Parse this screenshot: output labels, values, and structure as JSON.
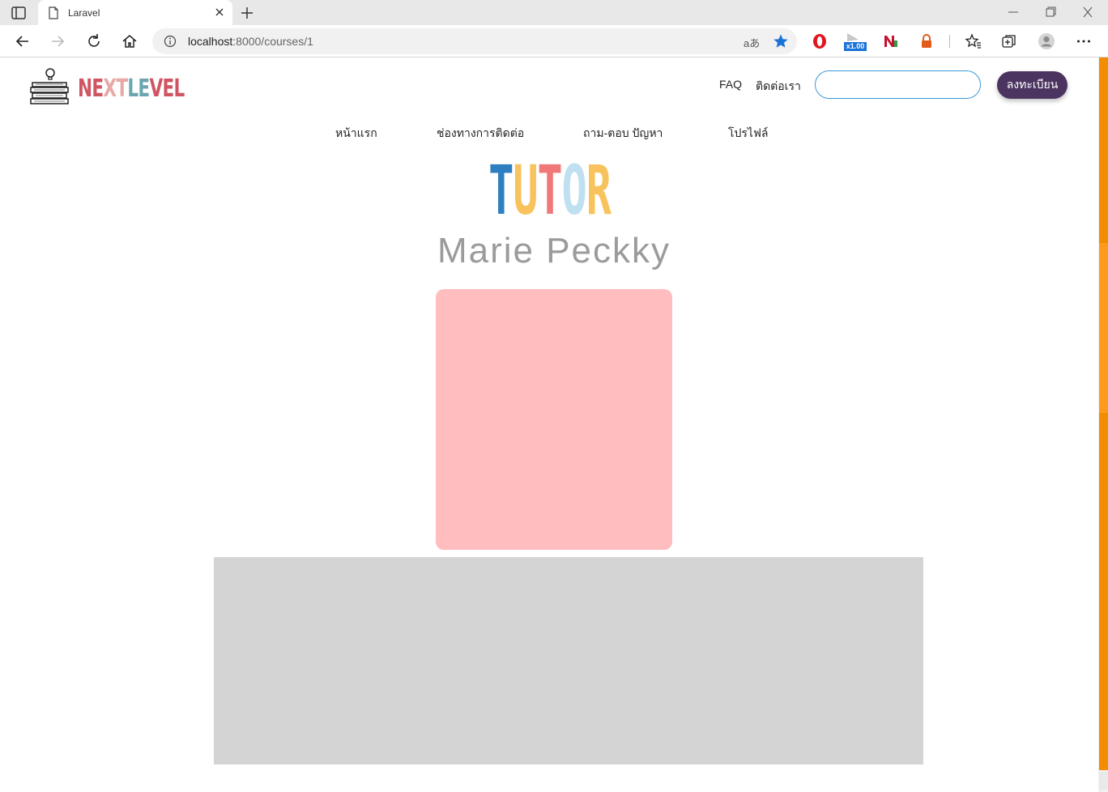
{
  "browser": {
    "tab_title": "Laravel",
    "url_host": "localhost",
    "url_rest": ":8000/courses/1",
    "read_aloud": "aあ",
    "extension_badge": "x1.00"
  },
  "header": {
    "logo_letters": [
      "N",
      "E",
      "X",
      "T",
      "L",
      "E",
      "V",
      "E",
      "L"
    ],
    "logo_colors": [
      "#d05563",
      "#d05563",
      "#e7a9a6",
      "#e7a9a6",
      "#6aa6b0",
      "#6aa6b0",
      "#d05563",
      "#d05563",
      "#d05563"
    ],
    "faq_label": "FAQ",
    "contact_label": "ติดต่อเรา",
    "search_value": "",
    "register_label": "ลงทะเบียน"
  },
  "nav": {
    "items": [
      "หน้าแรก",
      "ช่องทางการติดต่อ",
      "ถาม-ตอบ ปัญหา",
      "โปรไฟล์"
    ]
  },
  "main": {
    "heading_letters": [
      "T",
      "U",
      "T",
      "O",
      "R"
    ],
    "heading_colors": [
      "#2d7fc1",
      "#f8c35c",
      "#f07878",
      "#bfe0f0",
      "#f8c35c"
    ],
    "tutor_name": "Marie Peckky"
  },
  "colors": {
    "accent_purple": "#4b3560",
    "search_border": "#3a9ad9",
    "photo_placeholder": "#ffbdc0",
    "content_placeholder": "#d4d4d4",
    "scrollbar_accent": "#f28c00"
  }
}
